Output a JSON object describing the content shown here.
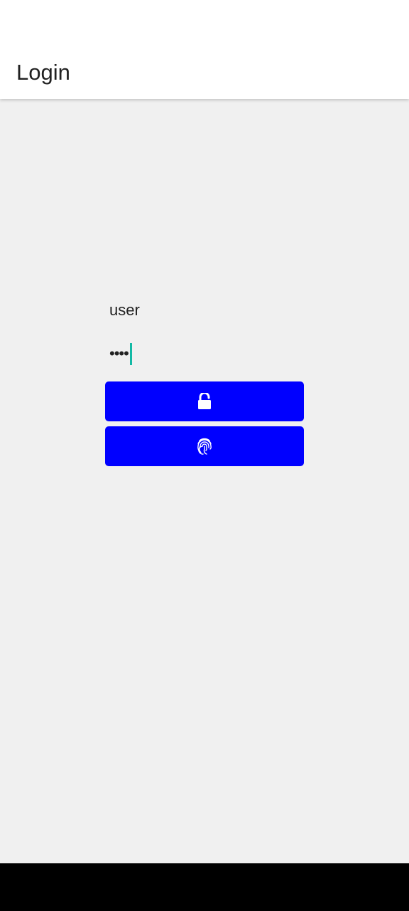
{
  "app_bar": {
    "title": "Login"
  },
  "form": {
    "username": "user",
    "password_masked": "••••",
    "login_button": {
      "icon": "unlock-icon"
    },
    "fingerprint_button": {
      "icon": "fingerprint-icon"
    }
  },
  "colors": {
    "background": "#f0f0f0",
    "app_bar": "#ffffff",
    "button": "#0000ff",
    "cursor": "#13b9a5",
    "text": "#222222",
    "nav_bar": "#000000"
  }
}
